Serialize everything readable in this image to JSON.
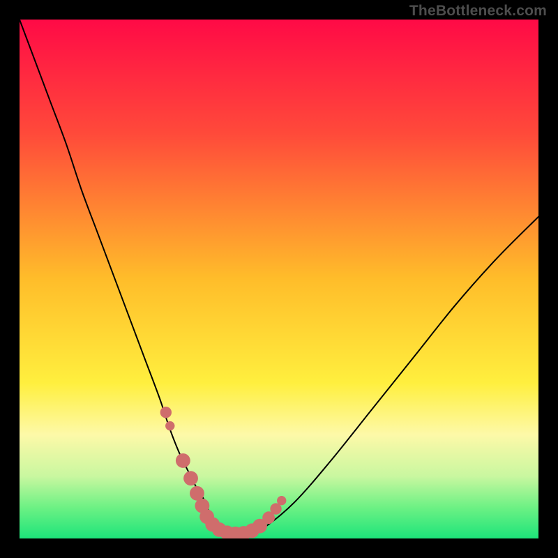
{
  "watermark": {
    "text": "TheBottleneck.com"
  },
  "colors": {
    "frame": "#000000",
    "curve": "#000000",
    "beads": "#cf6d6c",
    "gradient_stops": [
      {
        "pct": 0,
        "color": "#ff0a46"
      },
      {
        "pct": 22,
        "color": "#ff4a3a"
      },
      {
        "pct": 50,
        "color": "#ffbd2a"
      },
      {
        "pct": 70,
        "color": "#ffef3e"
      },
      {
        "pct": 80,
        "color": "#fdf9a8"
      },
      {
        "pct": 88,
        "color": "#c9f7a0"
      },
      {
        "pct": 94,
        "color": "#6df184"
      },
      {
        "pct": 100,
        "color": "#1de47a"
      }
    ]
  },
  "chart_data": {
    "type": "line",
    "title": "",
    "xlabel": "",
    "ylabel": "",
    "xlim": [
      0,
      100
    ],
    "ylim": [
      0,
      100
    ],
    "grid": false,
    "legend": false,
    "series": [
      {
        "name": "bottleneck-curve",
        "x": [
          0,
          3,
          6,
          9,
          12,
          15,
          18,
          21,
          24,
          27,
          29,
          31,
          33,
          34,
          35,
          36,
          37,
          38,
          40,
          42,
          44,
          47,
          53,
          60,
          68,
          76,
          84,
          92,
          100
        ],
        "y": [
          100,
          92,
          84,
          76,
          67,
          59,
          51,
          43,
          35,
          27,
          21,
          16,
          12,
          10,
          8.5,
          6.5,
          4,
          2.5,
          1.2,
          0.8,
          0.8,
          2,
          7,
          15,
          25,
          35,
          45,
          54,
          62
        ]
      }
    ],
    "markers": [
      {
        "x": 28.2,
        "y": 24.3,
        "r": 1.1
      },
      {
        "x": 29.0,
        "y": 21.7,
        "r": 0.9
      },
      {
        "x": 31.5,
        "y": 15.0,
        "r": 1.4
      },
      {
        "x": 33.0,
        "y": 11.6,
        "r": 1.4
      },
      {
        "x": 34.2,
        "y": 8.7,
        "r": 1.4
      },
      {
        "x": 35.2,
        "y": 6.3,
        "r": 1.4
      },
      {
        "x": 36.1,
        "y": 4.2,
        "r": 1.4
      },
      {
        "x": 37.2,
        "y": 2.7,
        "r": 1.4
      },
      {
        "x": 38.5,
        "y": 1.7,
        "r": 1.4
      },
      {
        "x": 40.0,
        "y": 1.1,
        "r": 1.4
      },
      {
        "x": 41.6,
        "y": 0.9,
        "r": 1.4
      },
      {
        "x": 43.2,
        "y": 1.0,
        "r": 1.4
      },
      {
        "x": 44.8,
        "y": 1.5,
        "r": 1.4
      },
      {
        "x": 46.3,
        "y": 2.4,
        "r": 1.4
      },
      {
        "x": 48.0,
        "y": 4.0,
        "r": 1.2
      },
      {
        "x": 49.4,
        "y": 5.7,
        "r": 1.1
      },
      {
        "x": 50.5,
        "y": 7.3,
        "r": 0.9
      }
    ]
  }
}
